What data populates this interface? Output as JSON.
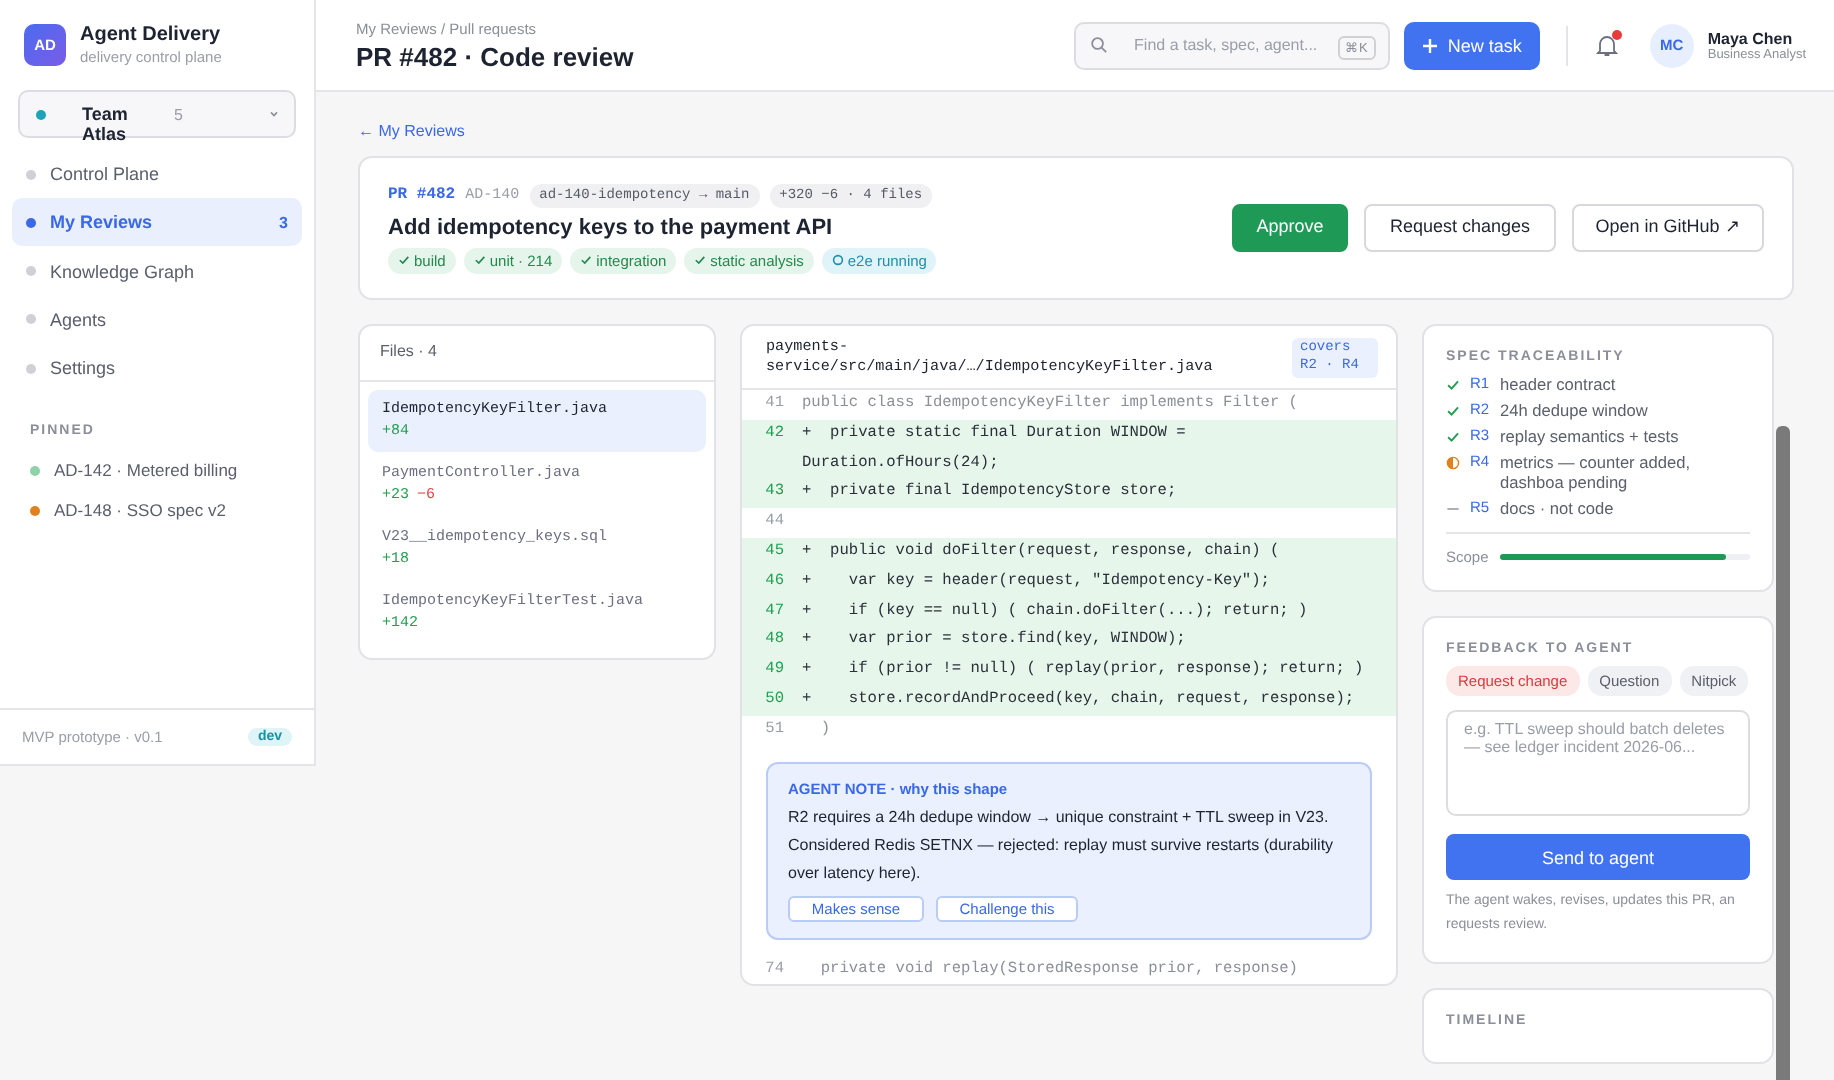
{
  "app": {
    "initials": "AD",
    "name": "Agent Delivery",
    "subtitle": "delivery control plane"
  },
  "team": {
    "name": "Team Atlas",
    "count": "5",
    "color": "#1ba3b8"
  },
  "nav": [
    {
      "label": "Control Plane",
      "selected": false
    },
    {
      "label": "My Reviews",
      "selected": true,
      "badge": "3"
    },
    {
      "label": "Knowledge Graph",
      "selected": false
    },
    {
      "label": "Agents",
      "selected": false
    },
    {
      "label": "Settings",
      "selected": false
    }
  ],
  "pinned": {
    "title": "PINNED",
    "items": [
      {
        "label": "AD-142 · Metered billing",
        "color": "#8fd1a8"
      },
      {
        "label": "AD-148 · SSO spec v2",
        "color": "#e0811f"
      }
    ]
  },
  "footer": {
    "text": "MVP prototype · v0.1",
    "badge": "dev"
  },
  "topbar": {
    "breadcrumb": "My Reviews / Pull requests",
    "title": "PR #482 · Code review",
    "search": {
      "placeholder": "Find a task, spec, agent...",
      "shortcut": "⌘K"
    },
    "new_task": "New task",
    "notifications": {
      "unread": true
    },
    "user": {
      "initials": "MC",
      "name": "Maya Chen",
      "role": "Business Analyst"
    }
  },
  "back_link": "← My Reviews",
  "pr": {
    "number": "PR #482",
    "ticket": "AD-140",
    "branch": "ad-140-idempotency → main",
    "stats": "+320 −6 · 4 files",
    "title": "Add idempotency keys to the payment API",
    "checks": [
      {
        "label": "build",
        "running": false
      },
      {
        "label": "unit · 214",
        "running": false
      },
      {
        "label": "integration",
        "running": false
      },
      {
        "label": "static analysis",
        "running": false
      },
      {
        "label": "e2e running",
        "running": true
      }
    ],
    "actions": [
      {
        "label": "Approve",
        "kind": "primary"
      },
      {
        "label": "Request changes",
        "kind": "secondary"
      },
      {
        "label": "Open in GitHub ↗",
        "kind": "secondary"
      }
    ]
  },
  "files": {
    "title": "Files · 4",
    "items": [
      {
        "name": "IdempotencyKeyFilter.java",
        "additions": "+84",
        "selected": true
      },
      {
        "name": "PaymentController.java",
        "additions": "+23",
        "deletions": "−6",
        "selected": false
      },
      {
        "name": "V23__idempotency_keys.sql",
        "additions": "+18",
        "selected": false
      },
      {
        "name": "IdempotencyKeyFilterTest.java",
        "additions": "+142",
        "selected": false
      }
    ]
  },
  "diff": {
    "path": "payments-service/src/main/java/…/IdempotencyKeyFilter.java",
    "covers": "covers R2 · R4",
    "lines": [
      {
        "number": "41",
        "kind": "context",
        "text": "public class IdempotencyKeyFilter implements Filter ("
      },
      {
        "number": "42",
        "kind": "added",
        "text": "+  private static final Duration WINDOW = Duration.ofHours(24);"
      },
      {
        "number": "43",
        "kind": "added",
        "text": "+  private final IdempotencyStore store;"
      },
      {
        "number": "44",
        "kind": "context"
      },
      {
        "number": "45",
        "kind": "added",
        "text": "+  public void doFilter(request, response, chain) ("
      },
      {
        "number": "46",
        "kind": "added",
        "text": "+    var key = header(request, \"Idempotency-Key\");"
      },
      {
        "number": "47",
        "kind": "added",
        "text": "+    if (key == null) ( chain.doFilter(...); return; )"
      },
      {
        "number": "48",
        "kind": "added",
        "text": "+    var prior = store.find(key, WINDOW);"
      },
      {
        "number": "49",
        "kind": "added",
        "text": "+    if (prior != null) ( replay(prior, response); return; )"
      },
      {
        "number": "50",
        "kind": "added",
        "text": "+    store.recordAndProceed(key, chain, request, response);"
      },
      {
        "number": "51",
        "kind": "context",
        "text": "  )"
      }
    ],
    "note": {
      "title": "AGENT NOTE · why this shape",
      "text": "R2 requires a 24h dedupe window → unique constraint + TTL sweep in V23. Considered Redis SETNX — rejected: replay must survive restarts (durability over latency here).",
      "actions": [
        "Makes sense",
        "Challenge this"
      ]
    },
    "trailing_lines": [
      {
        "number": "74",
        "text": "  private void replay(StoredResponse prior, response)"
      }
    ]
  },
  "traceability": {
    "title": "SPEC TRACEABILITY",
    "items": [
      {
        "id": "R1",
        "text": "header contract",
        "kind": "done"
      },
      {
        "id": "R2",
        "text": "24h dedupe window",
        "kind": "done"
      },
      {
        "id": "R3",
        "text": "replay semantics + tests",
        "kind": "done"
      },
      {
        "id": "R4",
        "text": "metrics — counter added, dashboa pending",
        "kind": "partial"
      },
      {
        "id": "R5",
        "text": "docs · not code",
        "kind": "na"
      }
    ],
    "scope": {
      "label": "Scope",
      "level": 0.9
    }
  },
  "feedback": {
    "title": "FEEDBACK TO AGENT",
    "types": [
      {
        "label": "Request change",
        "selected": true
      },
      {
        "label": "Question",
        "selected": false
      },
      {
        "label": "Nitpick",
        "selected": false
      }
    ],
    "placeholder": "e.g. TTL sweep should batch deletes — see ledger incident 2026-06...",
    "send": "Send to agent",
    "hint": "The agent wakes, revises, updates this PR, an requests review."
  },
  "timeline": {
    "title": "TIMELINE"
  }
}
